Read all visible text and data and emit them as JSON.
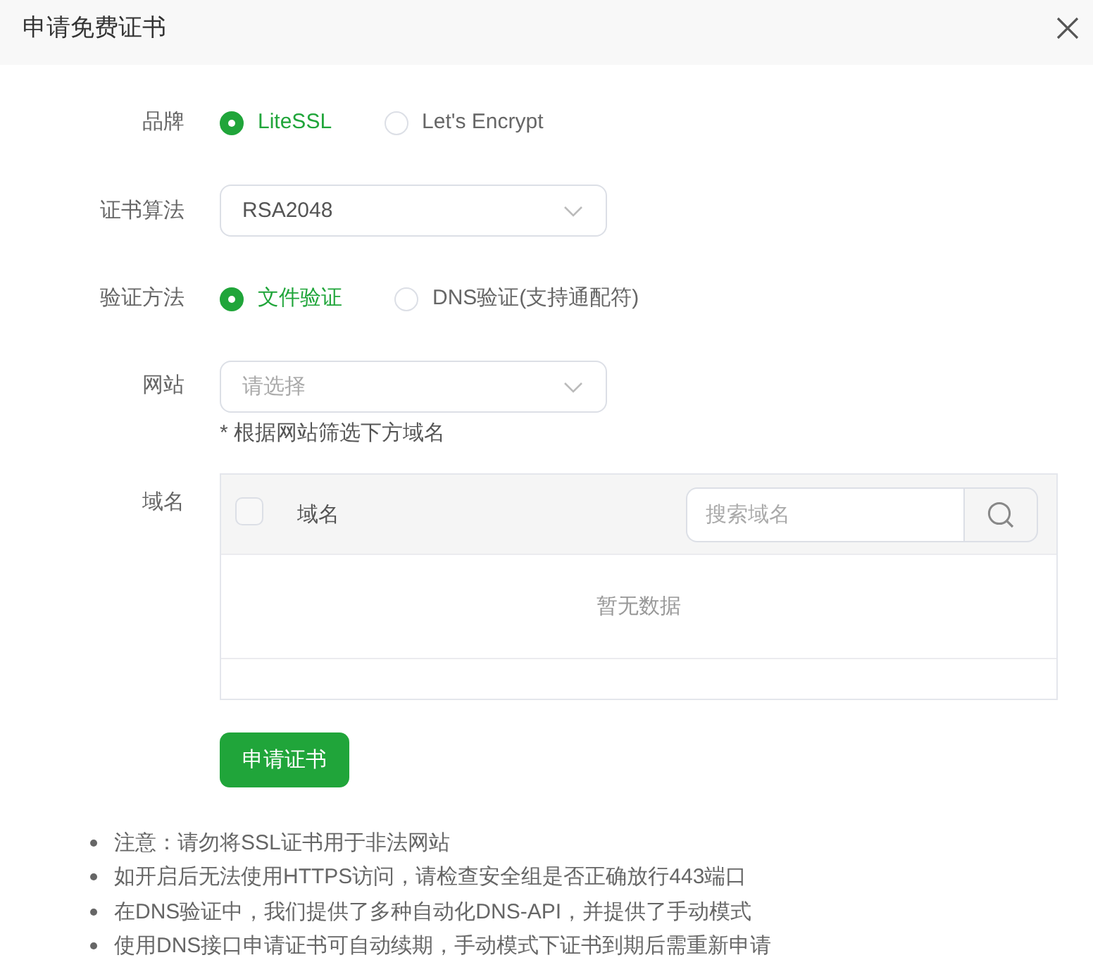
{
  "dialog": {
    "title": "申请免费证书"
  },
  "fields": [
    {
      "kind": "radio",
      "label": "品牌",
      "options": [
        {
          "label": "LiteSSL",
          "selected": true
        },
        {
          "label": "Let's Encrypt",
          "selected": false
        }
      ]
    },
    {
      "kind": "select",
      "label": "证书算法",
      "value": "RSA2048"
    },
    {
      "kind": "radio",
      "label": "验证方法",
      "options": [
        {
          "label": "文件验证",
          "selected": true
        },
        {
          "label": "DNS验证(支持通配符)",
          "selected": false
        }
      ]
    },
    {
      "kind": "select",
      "label": "网站",
      "placeholder": "请选择",
      "hint": "* 根据网站筛选下方域名"
    },
    {
      "kind": "table",
      "label": "域名",
      "table": {
        "select_all_checked": false,
        "columns": [
          "域名"
        ],
        "search": {
          "placeholder": "搜索域名"
        },
        "empty_text": "暂无数据"
      }
    }
  ],
  "submit_button": "申请证书",
  "notes": [
    "注意：请勿将SSL证书用于非法网站",
    "如开启后无法使用HTTPS访问，请检查安全组是否正确放行443端口",
    "在DNS验证中，我们提供了多种自动化DNS-API，并提供了手动模式",
    "使用DNS接口申请证书可自动续期，手动模式下证书到期后需重新申请"
  ]
}
